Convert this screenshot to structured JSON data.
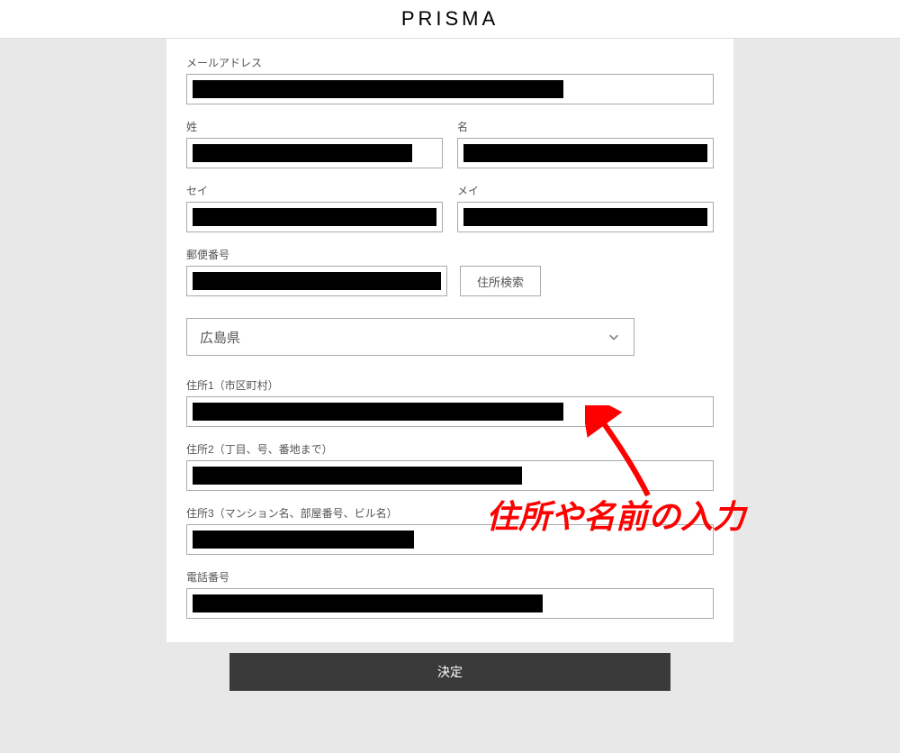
{
  "header": {
    "brand": "PRISMA"
  },
  "form": {
    "email": {
      "label": "メールアドレス",
      "redacted_width": "72%"
    },
    "last_name": {
      "label": "姓",
      "redacted_width": "90%"
    },
    "first_name": {
      "label": "名",
      "redacted_width": "100%"
    },
    "last_name_kana": {
      "label": "セイ",
      "redacted_width": "100%"
    },
    "first_name_kana": {
      "label": "メイ",
      "redacted_width": "100%"
    },
    "postal": {
      "label": "郵便番号",
      "redacted_width": "100%",
      "search_button": "住所検索"
    },
    "prefecture": {
      "selected": "広島県"
    },
    "address1": {
      "label": "住所1（市区町村）",
      "redacted_width": "72%"
    },
    "address2": {
      "label": "住所2（丁目、号、番地まで）",
      "redacted_width": "64%"
    },
    "address3": {
      "label": "住所3（マンション名、部屋番号、ビル名）",
      "redacted_width": "43%"
    },
    "phone": {
      "label": "電話番号",
      "redacted_width": "68%"
    },
    "submit": "決定"
  },
  "annotation": {
    "text": "住所や名前の入力"
  }
}
